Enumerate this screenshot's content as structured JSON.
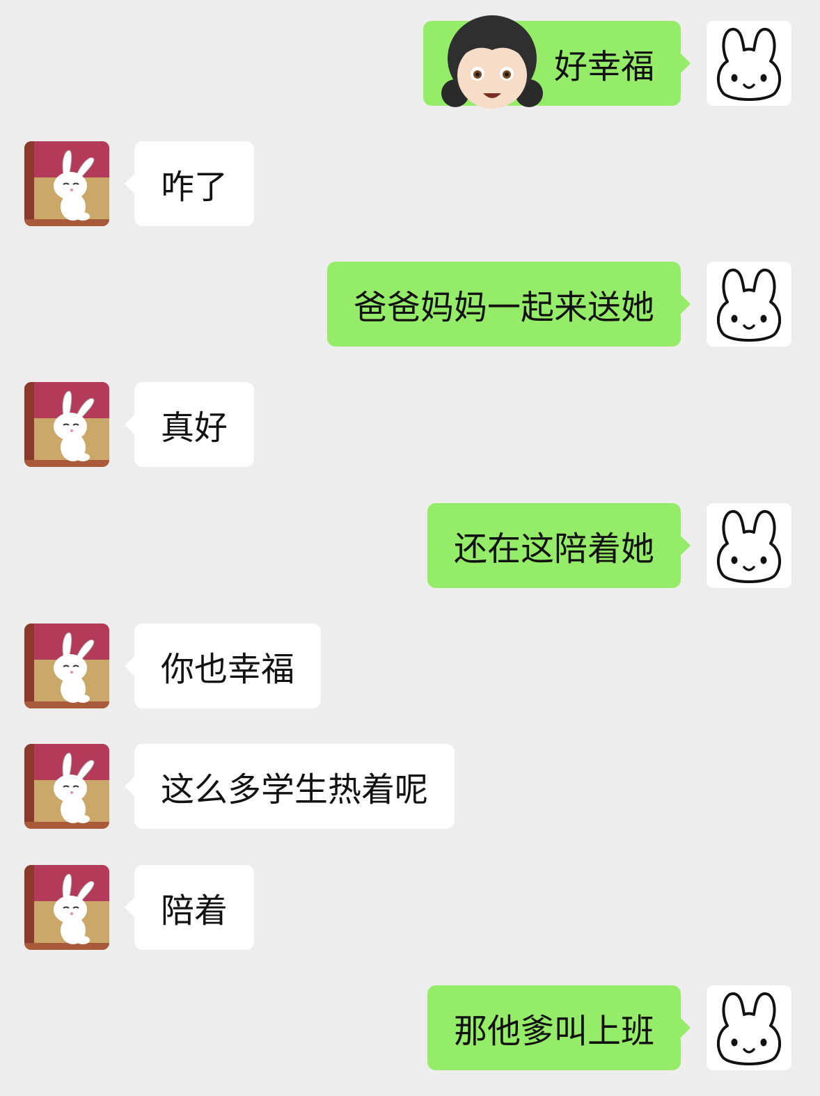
{
  "messages": [
    {
      "side": "right",
      "text": "好幸福",
      "sticker_icon": "girl-face-emoji-icon"
    },
    {
      "side": "left",
      "text": "咋了"
    },
    {
      "side": "right",
      "text": "爸爸妈妈一起来送她"
    },
    {
      "side": "left",
      "text": "真好"
    },
    {
      "side": "right",
      "text": "还在这陪着她"
    },
    {
      "side": "left",
      "text": "你也幸福"
    },
    {
      "side": "left",
      "text": "这么多学生热着呢"
    },
    {
      "side": "left",
      "text": "陪着"
    },
    {
      "side": "right",
      "text": "那他爹叫上班"
    }
  ],
  "avatars": {
    "self_icon": "white-bunny-avatar-icon",
    "other_icon": "cartoon-rabbit-avatar-icon"
  },
  "colors": {
    "background": "#ededed",
    "self_bubble": "#95ec69",
    "other_bubble": "#ffffff",
    "text": "#111111"
  }
}
